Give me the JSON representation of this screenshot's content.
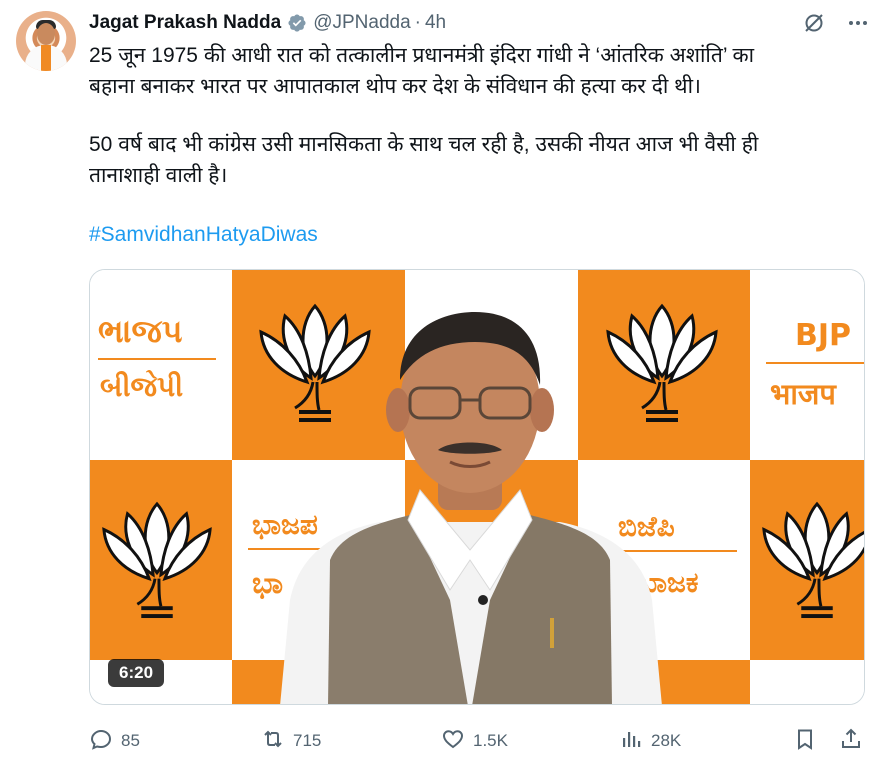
{
  "tweet": {
    "author_name": "Jagat Prakash Nadda",
    "handle": "@JPNadda",
    "separator": "·",
    "time": "4h",
    "text_p1": "25 जून 1975 की आधी रात को तत्कालीन प्रधानमंत्री इंदिरा गांधी ने ‘आंतरिक अशांति’ का\nबहाना बनाकर भारत पर आपातकाल थोप कर देश के संविधान की हत्या कर दी थी।",
    "text_p2": "50 वर्ष बाद भी कांग्रेस उसी मानसिकता के साथ चल रही है, उसकी नीयत आज भी वैसी ही\nतानाशाही वाली है।",
    "hashtag": "#SamvidhanHatyaDiwas"
  },
  "media": {
    "duration": "6:20",
    "backdrop_signs": [
      "ભાજપ",
      "બીજેપી",
      "BJP",
      "भाजप",
      "ಭಾಜಪ",
      "ಬಿಜೆಪಿ",
      "ಭಾ",
      "ಭಾಜಕ"
    ],
    "brand_orange": "#f28a1e"
  },
  "actions": {
    "reply_count": "85",
    "repost_count": "715",
    "like_count": "1.5K",
    "views_count": "28K"
  },
  "icons": {
    "verified": "verified-badge-icon",
    "grok": "grok-icon",
    "more": "more-icon",
    "reply": "reply-icon",
    "repost": "repost-icon",
    "like": "like-icon",
    "views": "views-icon",
    "bookmark": "bookmark-icon",
    "share": "share-icon"
  },
  "colors": {
    "accent": "#1d9bf0",
    "secondary_text": "#536471",
    "text": "#0f1419"
  }
}
